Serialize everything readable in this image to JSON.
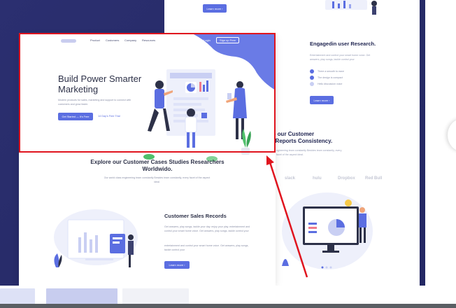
{
  "colors": {
    "accent": "#5b6ee1",
    "frame_red": "#e0141e",
    "navy": "#2a2f6b",
    "heading": "#2d3148"
  },
  "back_page": {
    "top_button": "Learn more  ›",
    "research_heading": "Engagedin user Research.",
    "research_text": "Entertainment and control your smart home voice. Get answers, play songs, tackle control your",
    "checks": [
      "There a smooth to eave",
      "The design is compact",
      "Hello discussion voice"
    ],
    "learn_button": "Learn more  ›",
    "partial_heading_1": "ore our Customer",
    "partial_heading_2": "ch Reports Consistency.",
    "partial_sub": "ngineering team constantly Besides team constantly, every facet of the aspect ideal.",
    "brands": [
      "slack",
      "hulu",
      "Dropbox",
      "Red Bull"
    ]
  },
  "nav": {
    "items": [
      "Product",
      "Customers",
      "Company",
      "Resources"
    ],
    "login": "Login",
    "signup": "Sign up Free"
  },
  "hero": {
    "title": "Build Power Smarter Marketing",
    "subtitle": "Modern products for sales, marketing and support to connect with customers and grow faster.",
    "cta": "Get Started — It's Free",
    "trial": "14 Day's Free Trial"
  },
  "explore": {
    "title": "Explore our Customer Cases Studies Researchers Worldwido.",
    "subtitle": "Our world class engineering team constantly Besides team constantly, every facet of the aspect ideal."
  },
  "records": {
    "title": "Customer Sales Records",
    "para1": "Get answers, play songs, tackle your day. enjoy your play. entertainment and control your smart home voice. Get answers, play songs, tackle control your",
    "para2": "entertainment and control your smart home voice. Get answers, play songs, tackle control your",
    "button": "Learn more  ›"
  }
}
